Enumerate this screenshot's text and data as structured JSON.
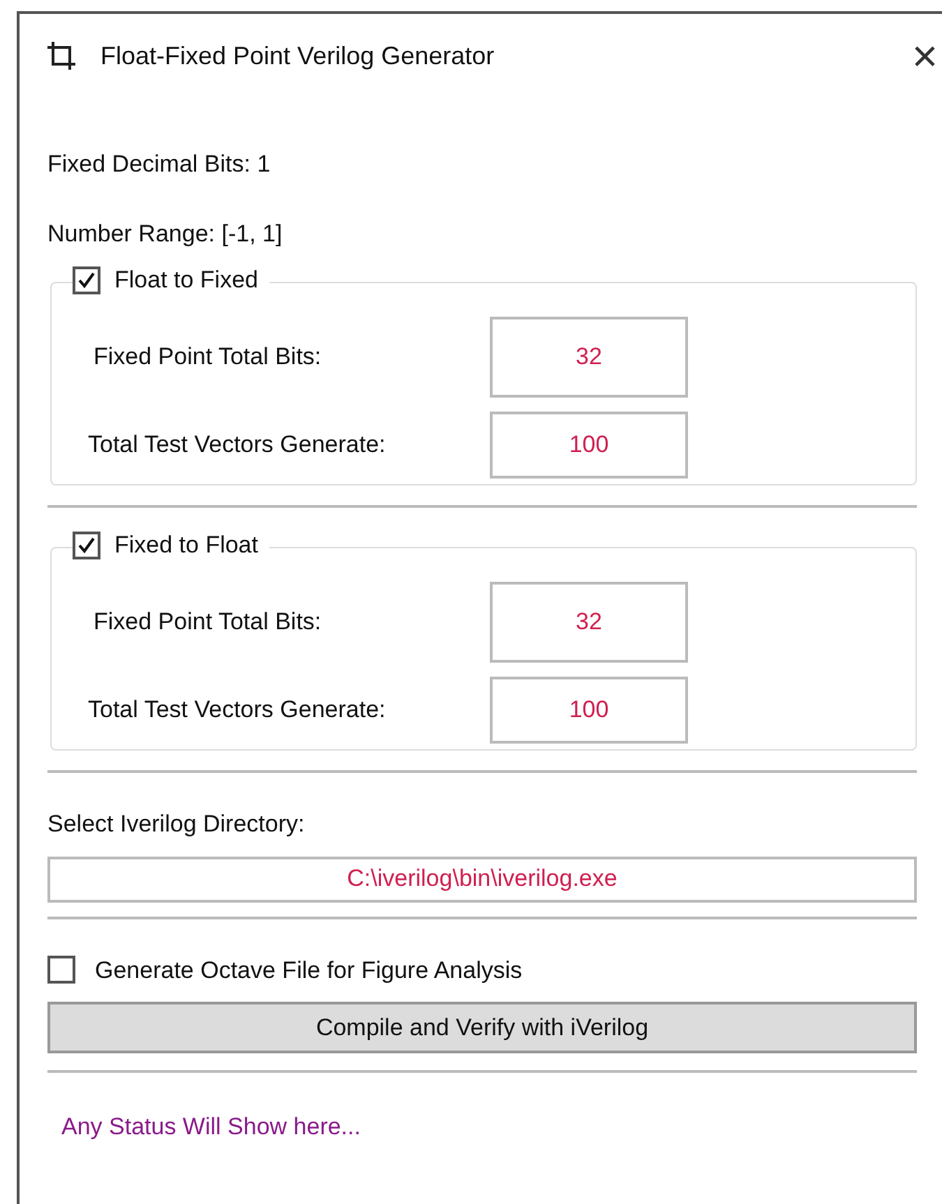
{
  "window": {
    "title": "Float-Fixed Point Verilog Generator",
    "close": "×"
  },
  "info": [
    "Fixed Decimal Bits: 1",
    "Number Range: [-1, 1]"
  ],
  "groups": [
    {
      "label": "Float to Fixed",
      "checked": true,
      "fields": [
        {
          "label": "Fixed Point Total Bits:",
          "value": "32",
          "kind": "tall"
        },
        {
          "label": "Total Test Vectors Generate:",
          "value": "100",
          "kind": "short"
        }
      ]
    },
    {
      "label": "Fixed to Float",
      "checked": true,
      "fields": [
        {
          "label": "Fixed Point Total Bits:",
          "value": "32",
          "kind": "tall"
        },
        {
          "label": "Total Test Vectors Generate:",
          "value": "100",
          "kind": "short"
        }
      ]
    }
  ],
  "directory": {
    "label": "Select Iverilog Directory:",
    "value": "C:\\iverilog\\bin\\iverilog.exe"
  },
  "octave": {
    "label": "Generate Octave File for Figure Analysis",
    "checked": false
  },
  "compile_button": "Compile and Verify with iVerilog",
  "status": "Any Status Will Show here..."
}
